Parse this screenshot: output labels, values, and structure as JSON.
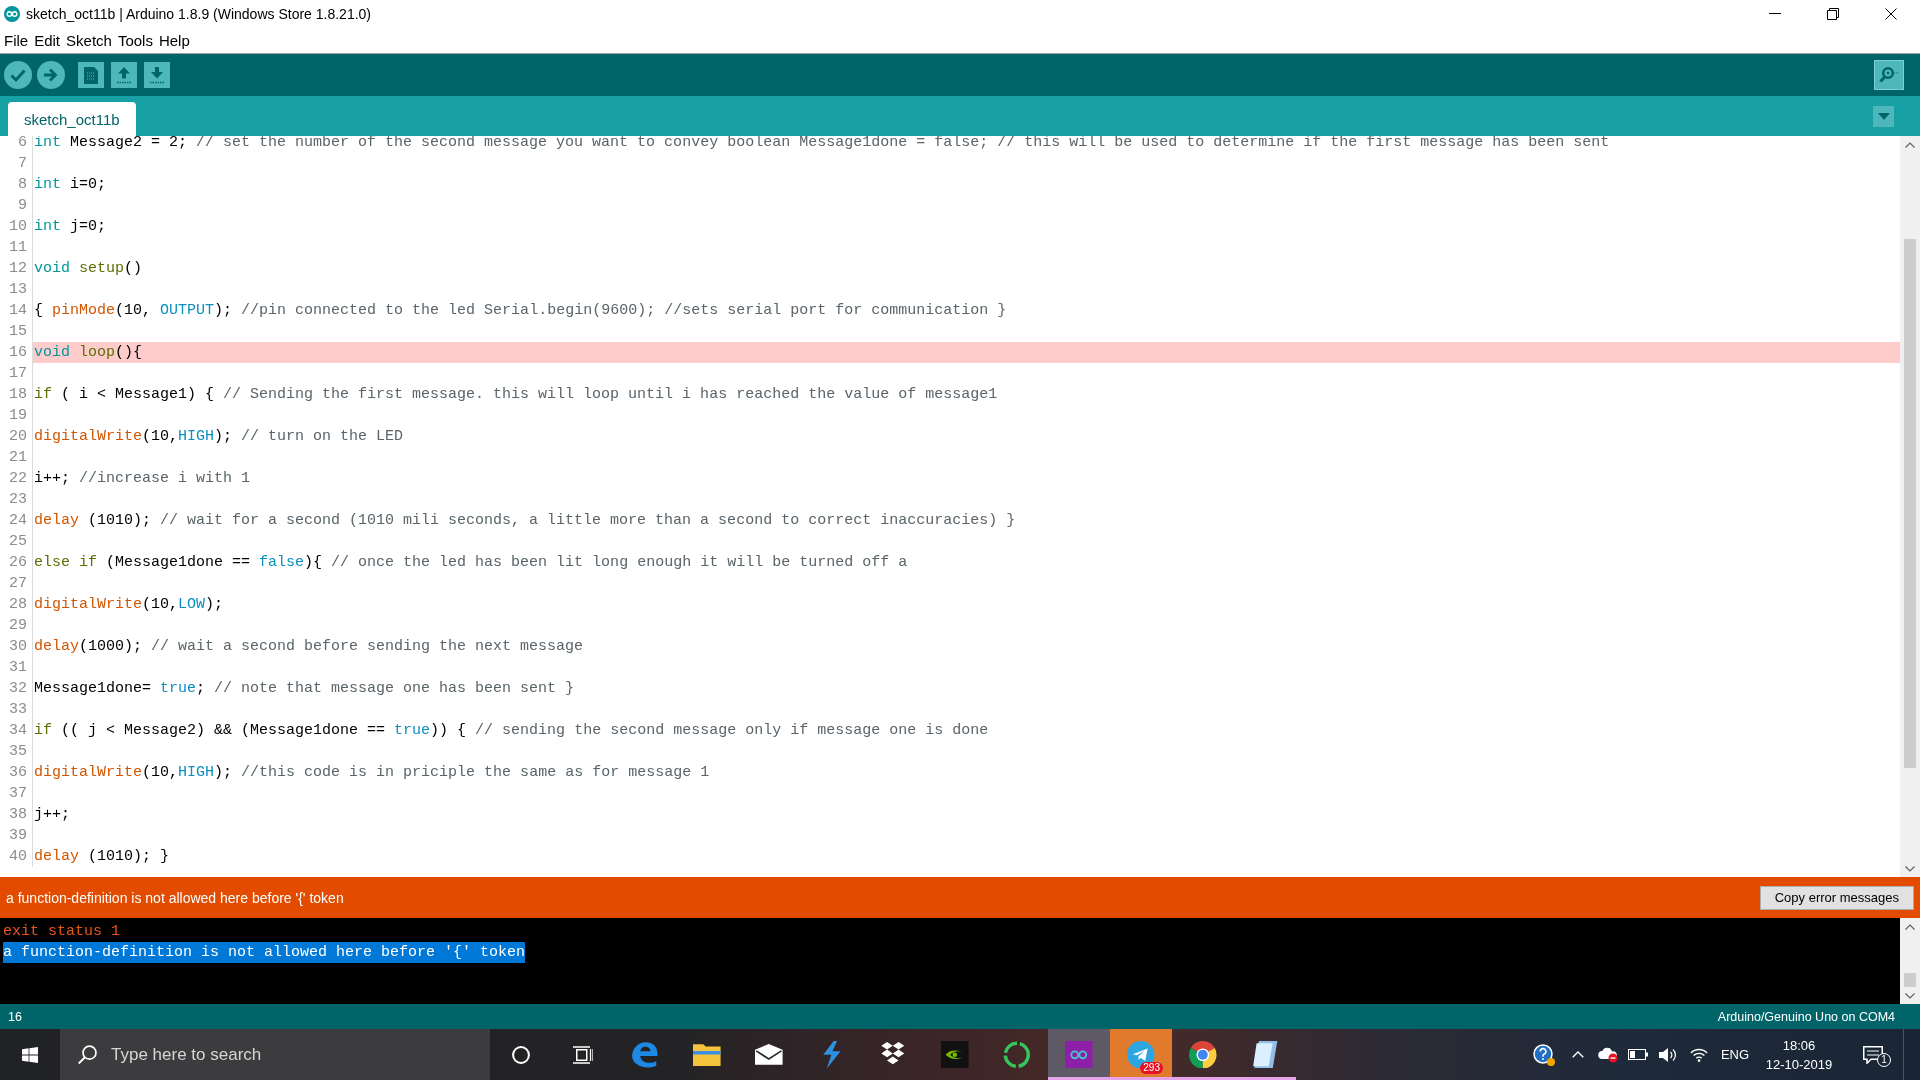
{
  "window": {
    "title": "sketch_oct11b | Arduino 1.8.9 (Windows Store 1.8.21.0)"
  },
  "menu": [
    "File",
    "Edit",
    "Sketch",
    "Tools",
    "Help"
  ],
  "tabs": [
    {
      "label": "sketch_oct11b",
      "selected": true
    }
  ],
  "editor": {
    "lines": [
      {
        "number": "6",
        "highlighted": false,
        "tokens": [
          {
            "kind": "keyword",
            "text": "int"
          },
          {
            "kind": "plain",
            "text": " Message2 = 2; "
          },
          {
            "kind": "comment",
            "text": "// set the number of the second message you want to convey boolean Message1done = false; // this will be used to determine if the first message has been sent"
          }
        ]
      },
      {
        "number": "7",
        "highlighted": false
      },
      {
        "number": "8",
        "highlighted": false,
        "tokens": [
          {
            "kind": "keyword",
            "text": "int"
          },
          {
            "kind": "plain",
            "text": " i=0;"
          }
        ]
      },
      {
        "number": "9",
        "highlighted": false
      },
      {
        "number": "10",
        "highlighted": false,
        "tokens": [
          {
            "kind": "keyword",
            "text": "int"
          },
          {
            "kind": "plain",
            "text": " j=0;"
          }
        ]
      },
      {
        "number": "11",
        "highlighted": false
      },
      {
        "number": "12",
        "highlighted": false,
        "tokens": [
          {
            "kind": "keyword",
            "text": "void "
          },
          {
            "kind": "structure",
            "text": "setup"
          },
          {
            "kind": "plain",
            "text": "()"
          }
        ]
      },
      {
        "number": "13",
        "highlighted": false
      },
      {
        "number": "14",
        "highlighted": false,
        "tokens": [
          {
            "kind": "plain",
            "text": "{ "
          },
          {
            "kind": "function",
            "text": "pinMode"
          },
          {
            "kind": "plain",
            "text": "(10, "
          },
          {
            "kind": "constant",
            "text": "OUTPUT"
          },
          {
            "kind": "plain",
            "text": "); "
          },
          {
            "kind": "comment",
            "text": "//pin connected to the led Serial.begin(9600); //sets serial port for communication }"
          }
        ]
      },
      {
        "number": "15",
        "highlighted": false
      },
      {
        "number": "16",
        "highlighted": true,
        "tokens": [
          {
            "kind": "keyword",
            "text": "void "
          },
          {
            "kind": "structure",
            "text": "loop"
          },
          {
            "kind": "plain",
            "text": "(){"
          }
        ]
      },
      {
        "number": "17",
        "highlighted": false
      },
      {
        "number": "18",
        "highlighted": false,
        "tokens": [
          {
            "kind": "structure",
            "text": "if"
          },
          {
            "kind": "plain",
            "text": " ( i < Message1) { "
          },
          {
            "kind": "comment",
            "text": "// Sending the first message. this will loop until i has reached the value of message1"
          }
        ]
      },
      {
        "number": "19",
        "highlighted": false
      },
      {
        "number": "20",
        "highlighted": false,
        "tokens": [
          {
            "kind": "function",
            "text": "digitalWrite"
          },
          {
            "kind": "plain",
            "text": "(10,"
          },
          {
            "kind": "constant",
            "text": "HIGH"
          },
          {
            "kind": "plain",
            "text": "); "
          },
          {
            "kind": "comment",
            "text": "// turn on the LED"
          }
        ]
      },
      {
        "number": "21",
        "highlighted": false
      },
      {
        "number": "22",
        "highlighted": false,
        "tokens": [
          {
            "kind": "plain",
            "text": "i++; "
          },
          {
            "kind": "comment",
            "text": "//increase i with 1"
          }
        ]
      },
      {
        "number": "23",
        "highlighted": false
      },
      {
        "number": "24",
        "highlighted": false,
        "tokens": [
          {
            "kind": "function",
            "text": "delay"
          },
          {
            "kind": "plain",
            "text": " (1010); "
          },
          {
            "kind": "comment",
            "text": "// wait for a second (1010 mili seconds, a little more than a second to correct inaccuracies) }"
          }
        ]
      },
      {
        "number": "25",
        "highlighted": false
      },
      {
        "number": "26",
        "highlighted": false,
        "tokens": [
          {
            "kind": "structure",
            "text": "else if"
          },
          {
            "kind": "plain",
            "text": " (Message1done == "
          },
          {
            "kind": "constant",
            "text": "false"
          },
          {
            "kind": "plain",
            "text": "){ "
          },
          {
            "kind": "comment",
            "text": "// once the led has been lit long enough it will be turned off a"
          }
        ]
      },
      {
        "number": "27",
        "highlighted": false
      },
      {
        "number": "28",
        "highlighted": false,
        "tokens": [
          {
            "kind": "function",
            "text": "digitalWrite"
          },
          {
            "kind": "plain",
            "text": "(10,"
          },
          {
            "kind": "constant",
            "text": "LOW"
          },
          {
            "kind": "plain",
            "text": ");"
          }
        ]
      },
      {
        "number": "29",
        "highlighted": false
      },
      {
        "number": "30",
        "highlighted": false,
        "tokens": [
          {
            "kind": "function",
            "text": "delay"
          },
          {
            "kind": "plain",
            "text": "(1000); "
          },
          {
            "kind": "comment",
            "text": "// wait a second before sending the next message"
          }
        ]
      },
      {
        "number": "31",
        "highlighted": false
      },
      {
        "number": "32",
        "highlighted": false,
        "tokens": [
          {
            "kind": "plain",
            "text": "Message1done= "
          },
          {
            "kind": "constant",
            "text": "true"
          },
          {
            "kind": "plain",
            "text": "; "
          },
          {
            "kind": "comment",
            "text": "// note that message one has been sent }"
          }
        ]
      },
      {
        "number": "33",
        "highlighted": false
      },
      {
        "number": "34",
        "highlighted": false,
        "tokens": [
          {
            "kind": "structure",
            "text": "if"
          },
          {
            "kind": "plain",
            "text": " (( j < Message2) && (Message1done == "
          },
          {
            "kind": "constant",
            "text": "true"
          },
          {
            "kind": "plain",
            "text": ")) { "
          },
          {
            "kind": "comment",
            "text": "// sending the second message only if message one is done"
          }
        ]
      },
      {
        "number": "35",
        "highlighted": false
      },
      {
        "number": "36",
        "highlighted": false,
        "tokens": [
          {
            "kind": "function",
            "text": "digitalWrite"
          },
          {
            "kind": "plain",
            "text": "(10,"
          },
          {
            "kind": "constant",
            "text": "HIGH"
          },
          {
            "kind": "plain",
            "text": "); "
          },
          {
            "kind": "comment",
            "text": "//this code is in priciple the same as for message 1"
          }
        ]
      },
      {
        "number": "37",
        "highlighted": false
      },
      {
        "number": "38",
        "highlighted": false,
        "tokens": [
          {
            "kind": "plain",
            "text": "j++;"
          }
        ]
      },
      {
        "number": "39",
        "highlighted": false
      },
      {
        "number": "40",
        "highlighted": false,
        "tokens": [
          {
            "kind": "function",
            "text": "delay"
          },
          {
            "kind": "plain",
            "text": " (1010); }"
          }
        ]
      }
    ]
  },
  "error_bar": {
    "message": "a function-definition is not allowed here before '{' token",
    "button": "Copy error messages"
  },
  "console": {
    "lines": [
      {
        "text": "exit status 1",
        "selected": false
      },
      {
        "text": "a function-definition is not allowed here before '{' token",
        "selected": true
      }
    ]
  },
  "status_bar": {
    "line": "16",
    "board": "Arduino/Genuino Uno on COM4"
  },
  "taskbar": {
    "search": {
      "placeholder": "Type here to search"
    },
    "apps": [
      {
        "kind": "edge",
        "running": false,
        "active": false,
        "attention": false
      },
      {
        "kind": "explorer",
        "running": false,
        "active": false,
        "attention": false
      },
      {
        "kind": "mail",
        "running": false,
        "active": false,
        "attention": false
      },
      {
        "kind": "lightning",
        "running": false,
        "active": false,
        "attention": false
      },
      {
        "kind": "dropbox",
        "running": false,
        "active": false,
        "attention": false
      },
      {
        "kind": "nvidia",
        "running": false,
        "active": false,
        "attention": false
      },
      {
        "kind": "ring",
        "running": false,
        "active": false,
        "attention": false
      },
      {
        "kind": "arduino",
        "running": true,
        "active": true,
        "attention": false
      },
      {
        "kind": "telegram",
        "running": true,
        "active": false,
        "attention": true,
        "badge": "293"
      },
      {
        "kind": "chrome",
        "running": true,
        "active": false,
        "attention": false
      },
      {
        "kind": "notes",
        "running": true,
        "active": false,
        "attention": false
      }
    ],
    "tray": {
      "language": "ENG",
      "time": "18:06",
      "date": "12-10-2019",
      "notifications": "1"
    }
  }
}
